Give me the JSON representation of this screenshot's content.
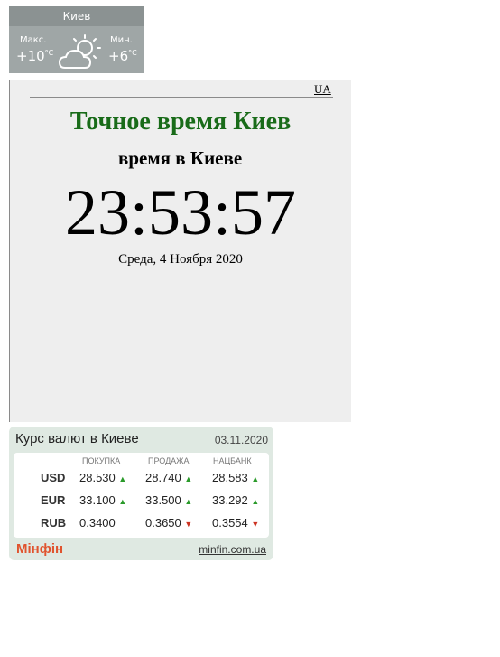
{
  "weather": {
    "city": "Киев",
    "max_label": "Макс.",
    "max_value": "+10",
    "min_label": "Мин.",
    "min_value": "+6",
    "unit": "°C",
    "icon": "sun-cloud-icon"
  },
  "clock": {
    "lang_link": "UA",
    "title": "Точное время Киев",
    "subtitle": "время в Киеве",
    "time": "23:53:57",
    "date": "Среда, 4 Ноября 2020"
  },
  "fx": {
    "title": "Курс валют в Киеве",
    "date": "03.11.2020",
    "columns": [
      "ПОКУПКА",
      "ПРОДАЖА",
      "НАЦБАНК"
    ],
    "rows": [
      {
        "currency": "USD",
        "buy": "28.530",
        "sell": "28.740",
        "nbu": "28.583"
      },
      {
        "currency": "EUR",
        "buy": "33.100",
        "sell": "33.500",
        "nbu": "33.292"
      },
      {
        "currency": "RUB",
        "buy": "0.3400",
        "sell": "0.3650",
        "nbu": "0.3554"
      }
    ],
    "brand": "Мінфін",
    "site": "minfin.com.ua",
    "colors": {
      "up": "#2a9a2a",
      "down": "#cc3322",
      "brand": "#e0542f"
    }
  }
}
